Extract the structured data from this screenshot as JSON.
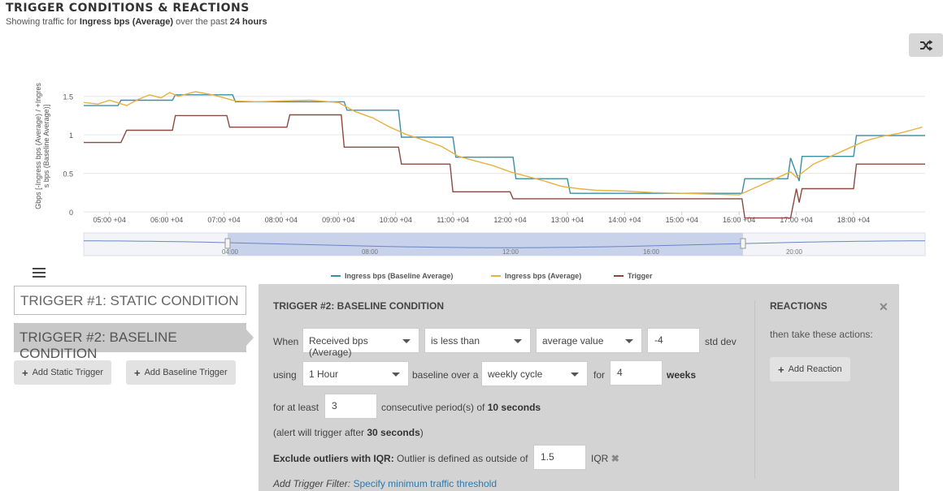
{
  "header": {
    "title": "TRIGGER CONDITIONS & REACTIONS",
    "subtitle_prefix": "Showing traffic for ",
    "metric": "Ingress bps (Average)",
    "subtitle_mid": " over the past ",
    "period": "24 hours"
  },
  "chart_data": {
    "type": "line",
    "ylabel": "Gbps [-Ingress bps (Average) / +Ingress bps (Baseline Average)]",
    "yticks": [
      "0",
      "0.5",
      "1",
      "1.5"
    ],
    "ylim": [
      0,
      1.75
    ],
    "xlim": [
      4.55,
      19.25
    ],
    "xticks": [
      "05:00 +04",
      "06:00 +04",
      "07:00 +04",
      "08:00 +04",
      "09:00 +04",
      "10:00 +04",
      "11:00 +04",
      "12:00 +04",
      "13:00 +04",
      "14:00 +04",
      "15:00 +04",
      "16:00 +04",
      "17:00 +04",
      "18:00 +04"
    ],
    "xtick_hours": [
      5,
      6,
      7,
      8,
      9,
      10,
      11,
      12,
      13,
      14,
      15,
      16,
      17,
      18
    ],
    "navigator_labels": [
      "04:00",
      "08:00",
      "12:00",
      "16:00",
      "20:00"
    ],
    "grid": true,
    "legend_position": "bottom",
    "series": [
      {
        "name": "Ingress bps (Baseline Average)",
        "color": "#3a8fa8",
        "x": [
          4.55,
          5.15,
          5.2,
          6.1,
          6.15,
          7.15,
          7.2,
          9.1,
          9.15,
          10.05,
          10.1,
          11.0,
          11.05,
          12.05,
          12.1,
          13.0,
          13.05,
          16.05,
          16.1,
          16.85,
          16.9,
          17.05,
          17.1,
          17.5,
          17.55,
          18.0,
          18.05,
          19.25
        ],
        "values": [
          1.38,
          1.38,
          1.45,
          1.45,
          1.52,
          1.52,
          1.43,
          1.43,
          1.32,
          1.32,
          0.97,
          0.97,
          0.71,
          0.71,
          0.43,
          0.43,
          0.24,
          0.24,
          0.43,
          0.43,
          0.7,
          0.4,
          0.72,
          0.72,
          0.72,
          0.72,
          0.99,
          0.99
        ]
      },
      {
        "name": "Ingress bps (Average)",
        "color": "#e8b040",
        "x": [
          4.55,
          4.8,
          5.0,
          5.3,
          5.5,
          5.7,
          5.9,
          6.05,
          6.2,
          6.5,
          6.8,
          7.0,
          7.2,
          7.6,
          8.0,
          8.5,
          9.0,
          9.3,
          9.6,
          9.9,
          10.2,
          10.5,
          10.8,
          11.1,
          11.4,
          11.7,
          12.0,
          12.3,
          12.6,
          12.9,
          13.2,
          13.5,
          14.0,
          14.5,
          15.0,
          15.5,
          16.0,
          16.3,
          16.6,
          16.9,
          17.0,
          17.3,
          17.6,
          17.9,
          18.2,
          18.5,
          18.8,
          19.0,
          19.2
        ],
        "values": [
          1.42,
          1.4,
          1.45,
          1.38,
          1.46,
          1.52,
          1.48,
          1.55,
          1.5,
          1.56,
          1.52,
          1.48,
          1.44,
          1.43,
          1.44,
          1.45,
          1.42,
          1.3,
          1.22,
          1.1,
          1.0,
          0.93,
          0.85,
          0.72,
          0.66,
          0.6,
          0.52,
          0.46,
          0.4,
          0.33,
          0.3,
          0.28,
          0.27,
          0.25,
          0.24,
          0.23,
          0.22,
          0.32,
          0.42,
          0.52,
          0.45,
          0.62,
          0.72,
          0.82,
          0.92,
          0.98,
          1.02,
          1.06,
          1.1
        ]
      },
      {
        "name": "Trigger",
        "color": "#8b4a40",
        "x": [
          4.55,
          5.2,
          5.3,
          6.1,
          6.15,
          7.05,
          7.1,
          8.1,
          8.15,
          9.05,
          9.1,
          10.05,
          10.1,
          10.95,
          11.0,
          12.0,
          12.05,
          16.05,
          16.1,
          16.9,
          17.0,
          17.05,
          17.1,
          17.5,
          17.55,
          18.0,
          18.05,
          19.25
        ],
        "values": [
          0.9,
          0.9,
          1.06,
          1.06,
          1.25,
          1.25,
          1.1,
          1.1,
          1.26,
          1.26,
          0.84,
          0.84,
          0.62,
          0.62,
          0.26,
          0.26,
          0.17,
          0.17,
          -0.08,
          -0.08,
          0.3,
          0.12,
          0.3,
          0.3,
          0.3,
          0.3,
          0.62,
          0.62
        ]
      }
    ]
  },
  "menu": {
    "icon": "hamburger-menu-icon"
  },
  "triggers": {
    "tab1": "TRIGGER #1: STATIC CONDITION",
    "tab2": "TRIGGER #2: BASELINE CONDITION",
    "add_static": "Add Static Trigger",
    "add_baseline": "Add Baseline Trigger"
  },
  "condition": {
    "title": "TRIGGER #2: BASELINE CONDITION",
    "when_label": "When",
    "metric_select": "Received bps (Average)",
    "operator_select": "is less than",
    "compare_select": "average value",
    "stddev_value": "-4",
    "stddev_label": "std dev",
    "using_label": "using",
    "interval_select": "1 Hour",
    "baseline_label": "baseline over a",
    "cycle_select": "weekly cycle",
    "for_label": "for",
    "weeks_value": "4",
    "weeks_label": "weeks",
    "atleast_label": "for at least",
    "periods_value": "3",
    "periods_text": "consecutive period(s) of ",
    "periods_duration": "10 seconds",
    "alert_prefix": "(alert will trigger after ",
    "alert_duration": "30 seconds",
    "alert_suffix": ")",
    "outlier_label": "Exclude outliers with IQR:",
    "outlier_text": " Outlier is defined as outside of",
    "iqr_value": "1.5",
    "iqr_label": "IQR",
    "filter_label": "Add Trigger Filter:",
    "filter_link": "Specify minimum traffic threshold"
  },
  "reactions": {
    "title": "REACTIONS",
    "text": "then take these actions:",
    "add_reaction": "Add Reaction"
  }
}
